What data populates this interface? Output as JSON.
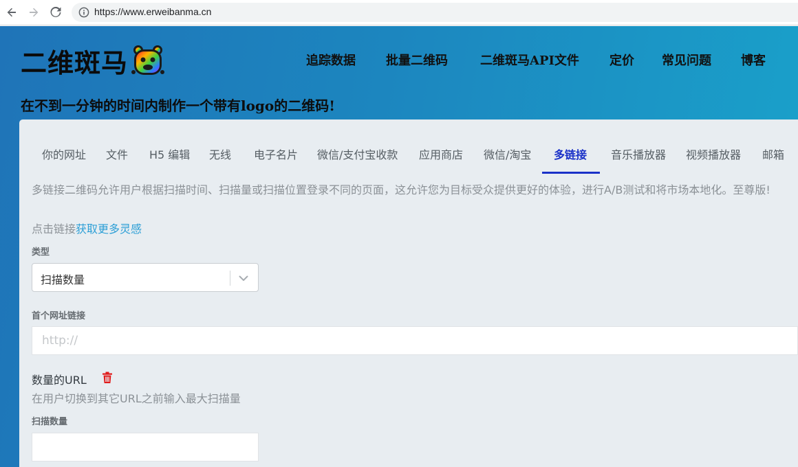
{
  "browser": {
    "url": "https://www.erweibanma.cn"
  },
  "header": {
    "logo_text": "二维斑马",
    "nav": [
      {
        "label": "追踪数据"
      },
      {
        "label": "批量二维码"
      },
      {
        "label": "二维斑马API文件"
      },
      {
        "label": "定价"
      },
      {
        "label": "常见问题"
      },
      {
        "label": "博客"
      }
    ],
    "tagline": "在不到一分钟的时间内制作一个带有logo的二维码!"
  },
  "tabs": [
    {
      "label": "你的网址"
    },
    {
      "label": "文件"
    },
    {
      "label": "H5 编辑"
    },
    {
      "label": "无线"
    },
    {
      "label": "电子名片"
    },
    {
      "label": "微信/支付宝收款"
    },
    {
      "label": "应用商店"
    },
    {
      "label": "微信/淘宝"
    },
    {
      "label": "多链接"
    },
    {
      "label": "音乐播放器"
    },
    {
      "label": "视频播放器"
    },
    {
      "label": "邮箱"
    }
  ],
  "active_tab": "多链接",
  "form": {
    "description": "多链接二维码允许用户根据扫描时间、扫描量或扫描位置登录不同的页面，这允许您为目标受众提供更好的体验，进行A/B测试和将市场本地化。至尊版!",
    "hint_prefix": "点击链接",
    "hint_link": "获取更多灵感",
    "type_label": "类型",
    "type_value": "扫描数量",
    "first_url_label": "首个网址链接",
    "first_url_placeholder": "http://",
    "count_section_title": "数量的URL",
    "count_section_sub": "在用户切换到其它URL之前输入最大扫描量",
    "scan_count_label": "扫描数量",
    "scan_count_value": ""
  },
  "colors": {
    "accent": "#1a31c8",
    "link": "#2d9fd6",
    "delete": "#e01b1b",
    "header_gradient_start": "#1f74b8",
    "header_gradient_end": "#1aa3cb"
  }
}
